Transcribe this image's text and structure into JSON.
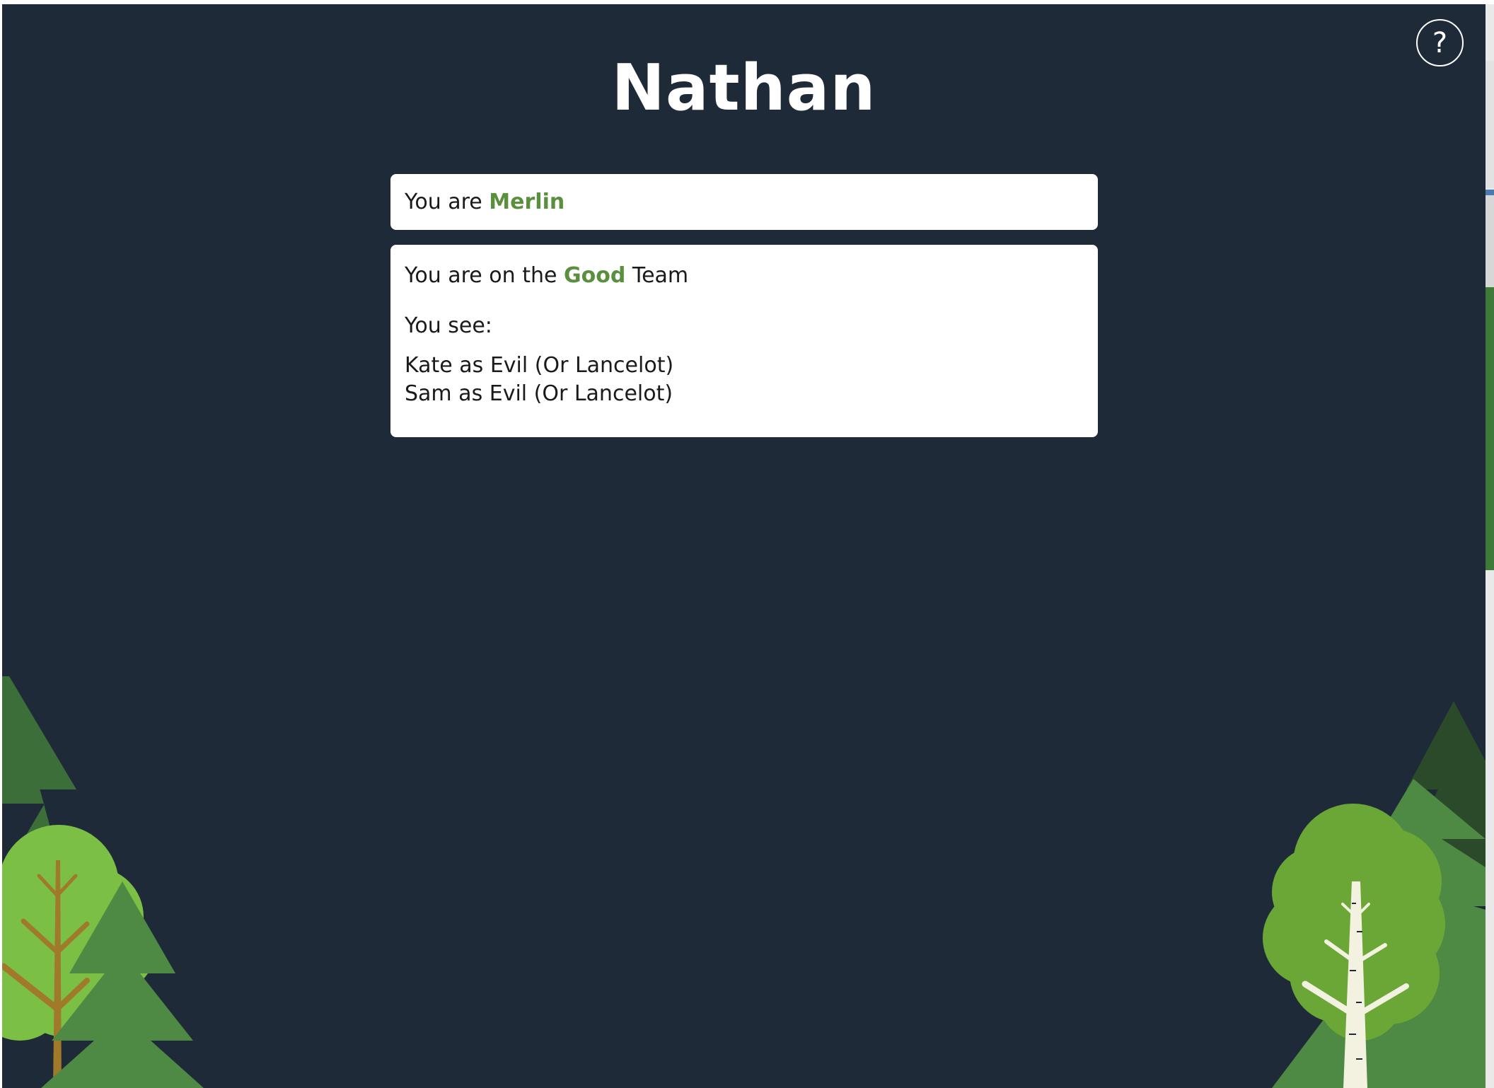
{
  "player": {
    "name": "Nathan"
  },
  "help": {
    "label": "?"
  },
  "role_card": {
    "prefix": "You are ",
    "role": "Merlin"
  },
  "team_card": {
    "prefix": "You are on the ",
    "team": "Good",
    "suffix": " Team",
    "see_label": "You see:",
    "seen": [
      "Kate as Evil (Or Lancelot)",
      "Sam as Evil (Or Lancelot)"
    ]
  },
  "colors": {
    "background": "#1e2a38",
    "accent_good": "#5a8f3e",
    "card": "#ffffff",
    "tree_light": "#7bbf45",
    "tree_mid": "#4f8a44",
    "tree_dark": "#3c6e3a",
    "tree_darkest": "#2a4a2a",
    "trunk_brown": "#a07a2a",
    "trunk_birch": "#f3f1df"
  },
  "decorations": {
    "scenery": "forest-trees"
  }
}
